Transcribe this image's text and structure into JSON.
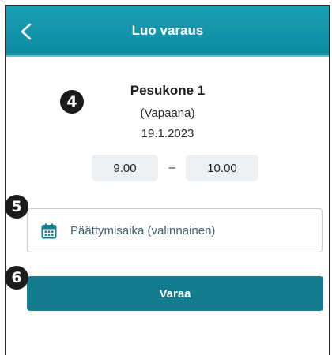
{
  "header": {
    "title": "Luo varaus",
    "back_icon": "chevron-left-icon",
    "background": "#1b9fb4"
  },
  "booking": {
    "name": "Pesukone 1",
    "status": "(Vapaana)",
    "date": "19.1.2023",
    "start_time": "9.00",
    "separator": "–",
    "end_time": "10.00"
  },
  "end_time_field": {
    "icon": "calendar-icon",
    "placeholder": "Päättymisaika (valinnainen)"
  },
  "book_button": {
    "label": "Varaa",
    "color": "#137c8f"
  },
  "step_badges": [
    "4",
    "5",
    "6"
  ]
}
